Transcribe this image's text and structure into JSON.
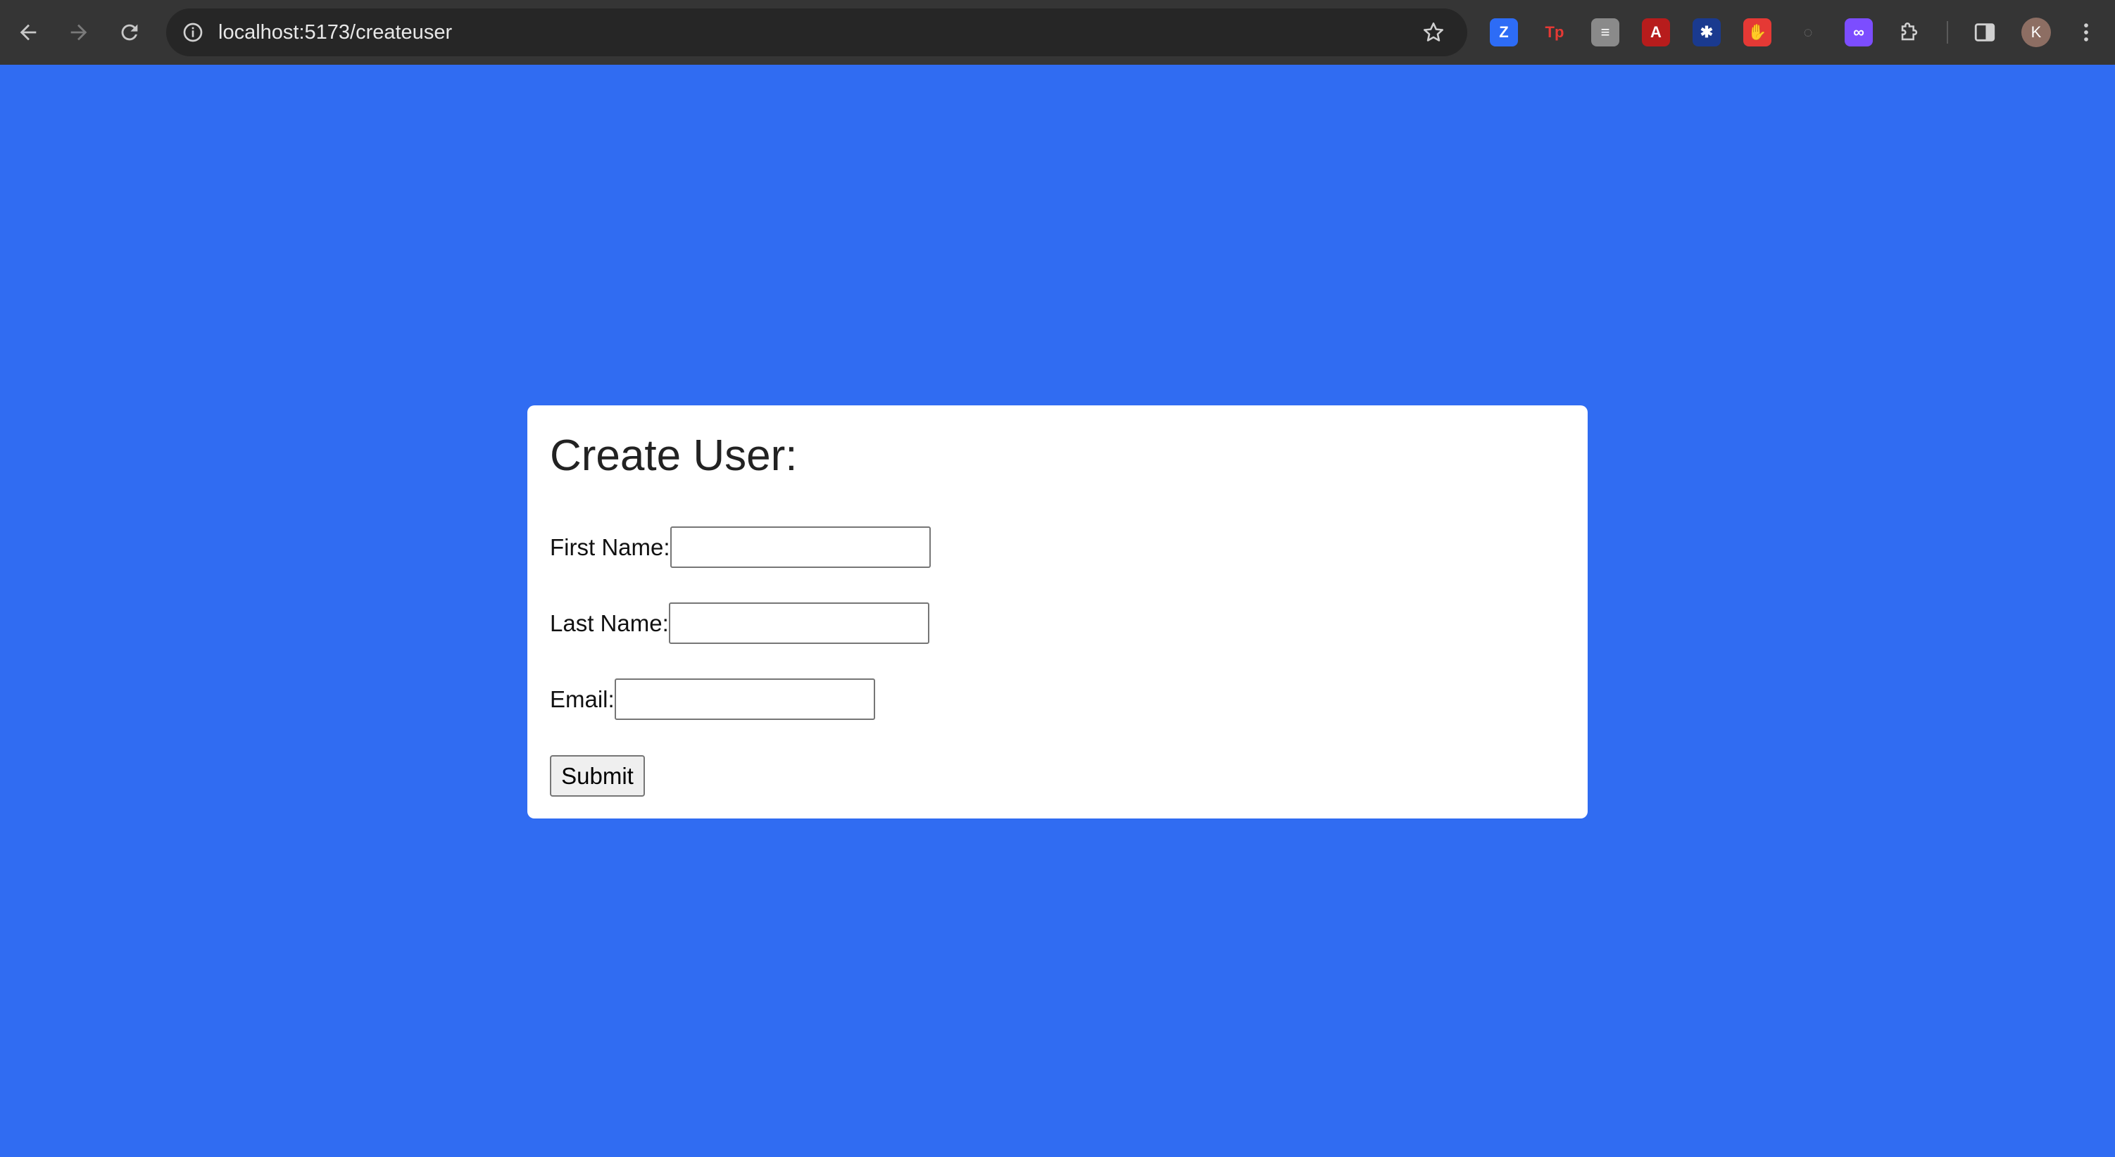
{
  "browser": {
    "url": "localhost:5173/createuser",
    "profile_initial": "K",
    "extensions": [
      {
        "name": "zoom-extension-icon",
        "glyph": "Z",
        "bg": "#2d6cf6"
      },
      {
        "name": "tp-extension-icon",
        "glyph": "Tp",
        "bg": "transparent",
        "fg": "#e53935"
      },
      {
        "name": "notes-extension-icon",
        "glyph": "≡",
        "bg": "#8a8a8a"
      },
      {
        "name": "acrobat-extension-icon",
        "glyph": "A",
        "bg": "#b71c1c"
      },
      {
        "name": "translate-extension-icon",
        "glyph": "✱",
        "bg": "#1a3a8f"
      },
      {
        "name": "blocker-extension-icon",
        "glyph": "✋",
        "bg": "#e53935"
      },
      {
        "name": "screenshot-extension-icon",
        "glyph": "◌",
        "bg": "transparent",
        "fg": "#777"
      },
      {
        "name": "purple-extension-icon",
        "glyph": "∞",
        "bg": "#7c4dff"
      }
    ]
  },
  "form": {
    "title": "Create User:",
    "first_name_label": "First Name:",
    "first_name_value": "",
    "last_name_label": "Last Name:",
    "last_name_value": "",
    "email_label": "Email:",
    "email_value": "",
    "submit_label": "Submit"
  },
  "colors": {
    "page_background": "#306cf2",
    "card_background": "#ffffff",
    "toolbar_background": "#353535"
  }
}
